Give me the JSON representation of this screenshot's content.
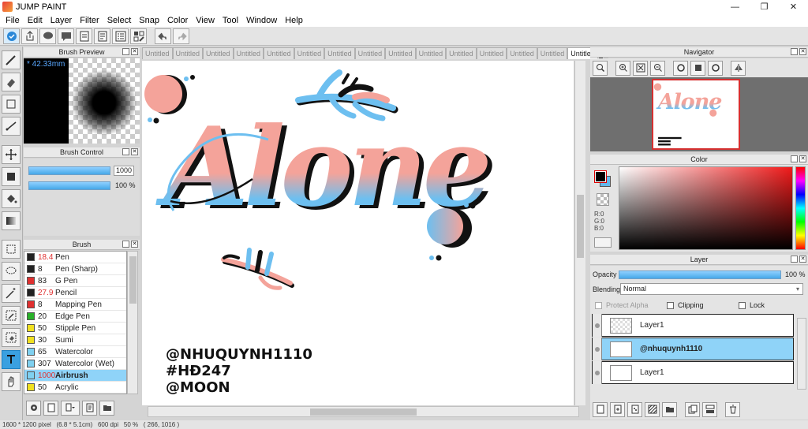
{
  "window": {
    "title": "JUMP PAINT",
    "minimize": "—",
    "maximize": "❐",
    "close": "✕"
  },
  "menu": [
    "File",
    "Edit",
    "Layer",
    "Filter",
    "Select",
    "Snap",
    "Color",
    "View",
    "Tool",
    "Window",
    "Help"
  ],
  "panels": {
    "brush_preview": {
      "title": "Brush Preview",
      "size": "* 42.33mm"
    },
    "brush_control": {
      "title": "Brush Control",
      "size_value": "1000",
      "opacity_value": "100 %"
    },
    "brush": {
      "title": "Brush",
      "items": [
        {
          "num": "18.4",
          "name": "Pen",
          "color": "#222222",
          "num_color": "#e03030"
        },
        {
          "num": "8",
          "name": "Pen (Sharp)",
          "color": "#222222",
          "num_color": "#222222"
        },
        {
          "num": "83",
          "name": "G Pen",
          "color": "#e03030",
          "num_color": "#222222"
        },
        {
          "num": "27.9",
          "name": "Pencil",
          "color": "#222222",
          "num_color": "#e03030"
        },
        {
          "num": "8",
          "name": "Mapping Pen",
          "color": "#e03030",
          "num_color": "#222222"
        },
        {
          "num": "20",
          "name": "Edge Pen",
          "color": "#28b028",
          "num_color": "#222222"
        },
        {
          "num": "50",
          "name": "Stipple Pen",
          "color": "#f0e020",
          "num_color": "#222222"
        },
        {
          "num": "30",
          "name": "Sumi",
          "color": "#f0e020",
          "num_color": "#222222"
        },
        {
          "num": "65",
          "name": "Watercolor",
          "color": "#7fd0f0",
          "num_color": "#222222"
        },
        {
          "num": "307",
          "name": "Watercolor (Wet)",
          "color": "#7fd0f0",
          "num_color": "#222222"
        },
        {
          "num": "1000",
          "name": "Airbrush",
          "color": "#7fd0f0",
          "num_color": "#e03030"
        },
        {
          "num": "50",
          "name": "Acrylic",
          "color": "#f0e020",
          "num_color": "#222222"
        }
      ]
    },
    "navigator": {
      "title": "Navigator"
    },
    "color": {
      "title": "Color",
      "r": "R:0",
      "g": "G:0",
      "b": "B:0"
    },
    "layer": {
      "title": "Layer",
      "opacity_label": "Opacity",
      "opacity_value": "100 %",
      "blending_label": "Blending",
      "blending_value": "Normal",
      "protect_alpha": "Protect Alpha",
      "clipping": "Clipping",
      "lock": "Lock",
      "layers": [
        {
          "name": "Layer1"
        },
        {
          "name": "@nhuquynh1110"
        },
        {
          "name": "Layer1"
        }
      ]
    }
  },
  "tabs": [
    "Untitled",
    "Untitled",
    "Untitled",
    "Untitled",
    "Untitled",
    "Untitled",
    "Untitled",
    "Untitled",
    "Untitled",
    "Untitled",
    "Untitled",
    "Untitled",
    "Untitled",
    "Untitled",
    "Untitled"
  ],
  "canvas": {
    "word": "Alone",
    "credit_lines": [
      "@NHUQUYNH1110",
      "#HĐ247",
      "@MOON"
    ],
    "colors": {
      "pink": "#f4a39a",
      "blue": "#6dbff0",
      "ink": "#111111"
    }
  },
  "status": "1600 * 1200 pixel   (6.8 * 5.1cm)   600 dpi   50 %   ( 266, 1016 )"
}
